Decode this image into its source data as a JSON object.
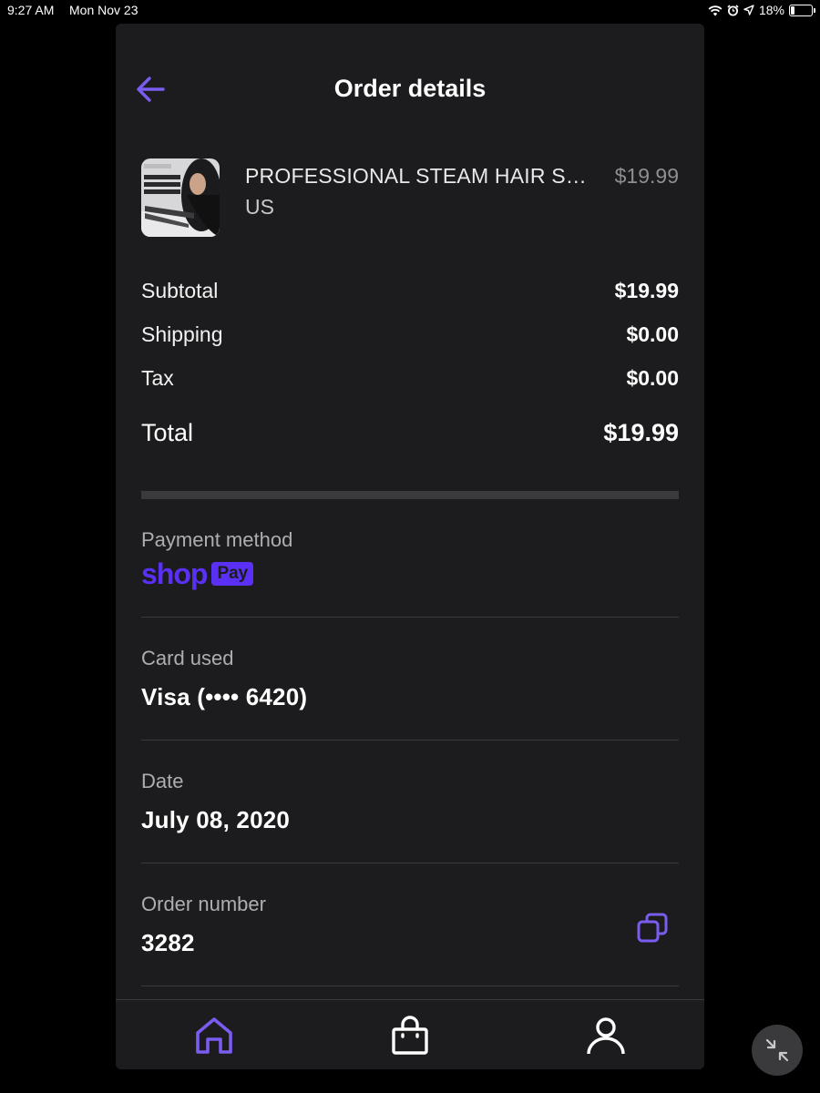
{
  "status_bar": {
    "time": "9:27 AM",
    "date": "Mon Nov 23",
    "battery": "18%",
    "battery_level": 0.18
  },
  "header": {
    "title": "Order details",
    "back_icon": "arrow-left-icon"
  },
  "product": {
    "name": "PROFESSIONAL STEAM HAIR STRAIGHTENER",
    "price": "$19.99",
    "variant": "US"
  },
  "summary": {
    "rows": [
      {
        "label": "Subtotal",
        "value": "$19.99"
      },
      {
        "label": "Shipping",
        "value": "$0.00"
      },
      {
        "label": "Tax",
        "value": "$0.00"
      }
    ],
    "total_label": "Total",
    "total_value": "$19.99"
  },
  "payment": {
    "label": "Payment method",
    "brand_shop": "shop",
    "brand_pay": "Pay"
  },
  "card": {
    "label": "Card used",
    "value": "Visa (•••• 6420)"
  },
  "date": {
    "label": "Date",
    "value": "July 08, 2020"
  },
  "order": {
    "label": "Order number",
    "value": "3282"
  },
  "tabs": [
    {
      "name": "home",
      "icon": "home-icon",
      "active": true
    },
    {
      "name": "orders",
      "icon": "shopping-bag-icon",
      "active": false
    },
    {
      "name": "account",
      "icon": "user-icon",
      "active": false
    }
  ],
  "colors": {
    "accent": "#7b5cf0",
    "brand": "#5a31f4",
    "background": "#1c1c1e",
    "divider": "#3a3a3c"
  }
}
